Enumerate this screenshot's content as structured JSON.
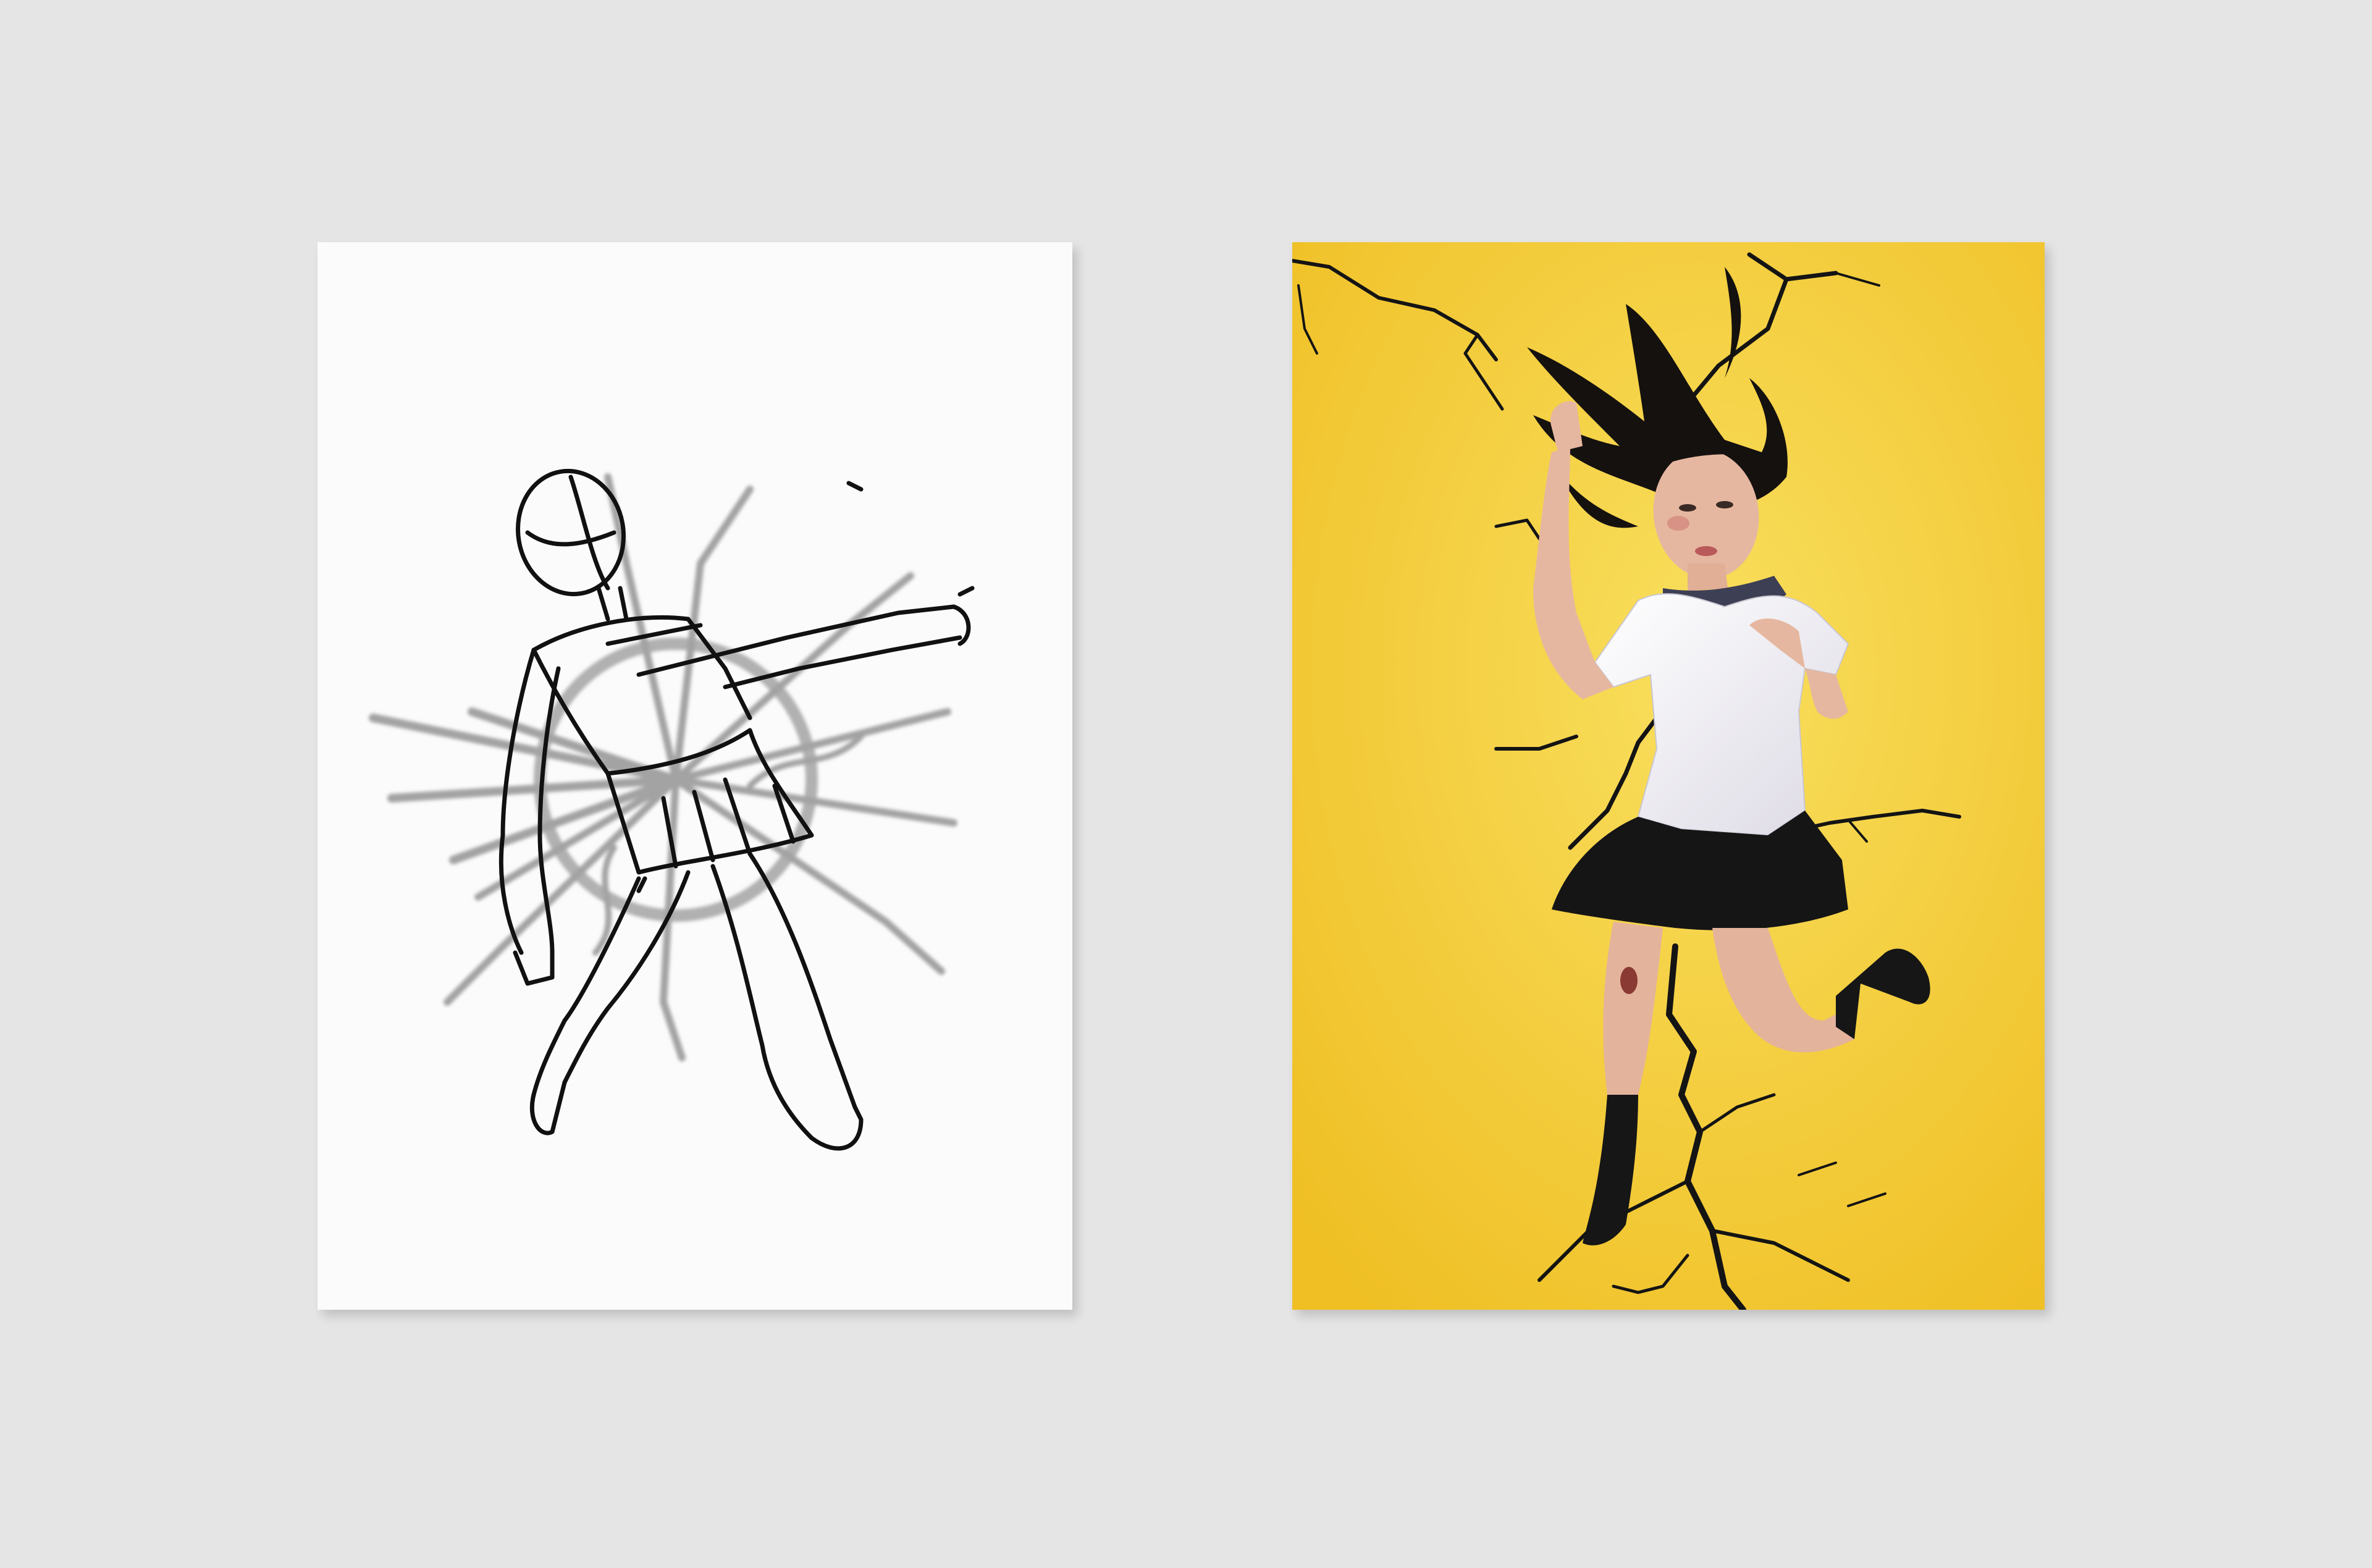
{
  "colors": {
    "background": "#e5e5e5",
    "sketch_paper": "#fbfbfb",
    "sketch_ink": "#111111",
    "sketch_crack_gray": "#a0a0a0",
    "photo_yellow_light": "#f9df5e",
    "photo_yellow_dark": "#efbf24",
    "crack_black": "#141414",
    "uniform_shirt": "#f4f2f6",
    "uniform_skirt": "#151515"
  },
  "icons": {
    "sketch": "figure-sketch-icon",
    "photo": "figure-photo-icon"
  }
}
